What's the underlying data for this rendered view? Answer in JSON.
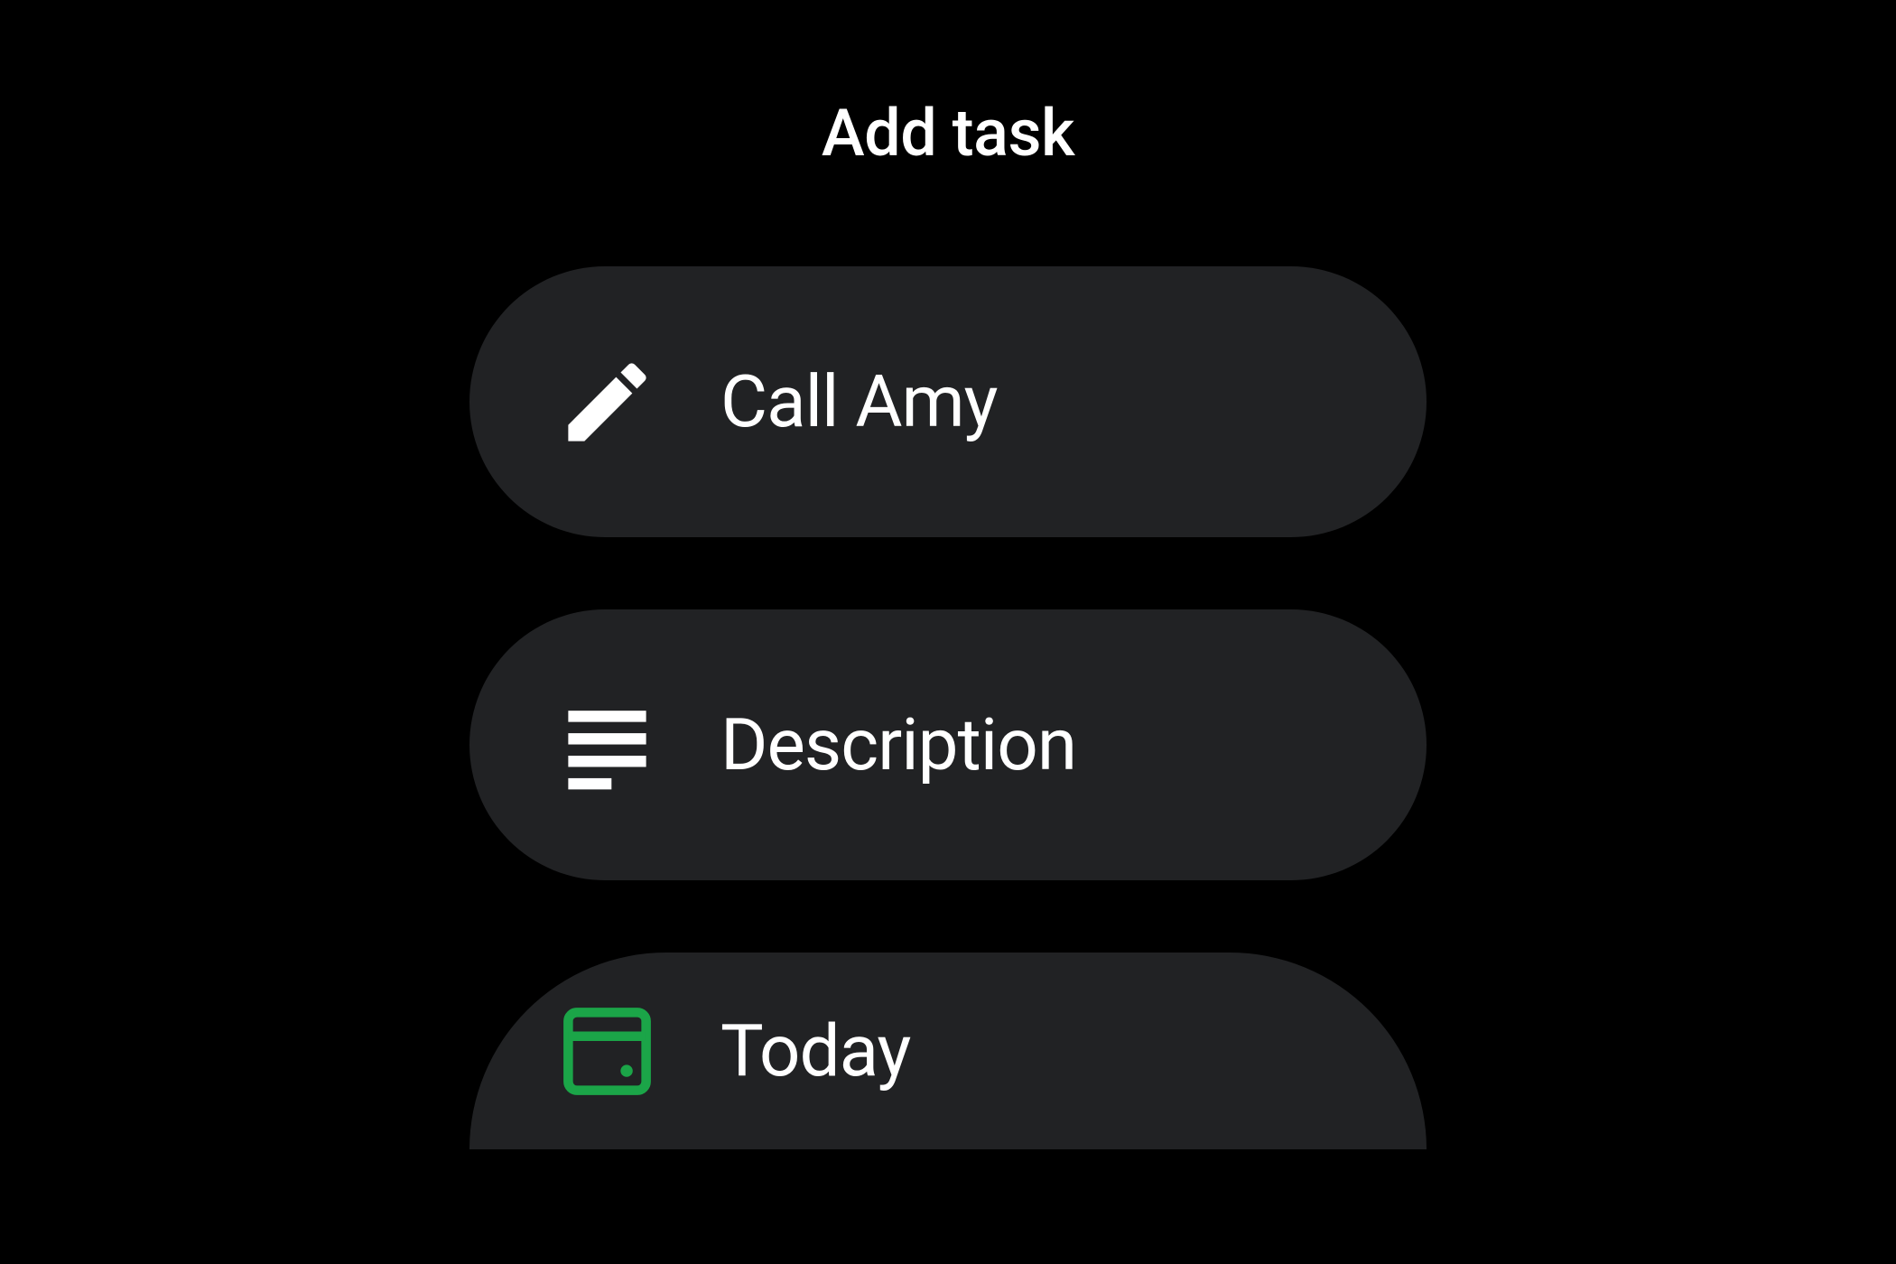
{
  "header": {
    "title": "Add task"
  },
  "items": [
    {
      "label": "Call Amy",
      "icon": "pencil"
    },
    {
      "label": "Description",
      "icon": "notes"
    },
    {
      "label": "Today",
      "icon": "calendar-today"
    }
  ],
  "colors": {
    "background": "#000000",
    "card": "#212224",
    "text": "#ffffff",
    "accent": "#1ba548"
  }
}
